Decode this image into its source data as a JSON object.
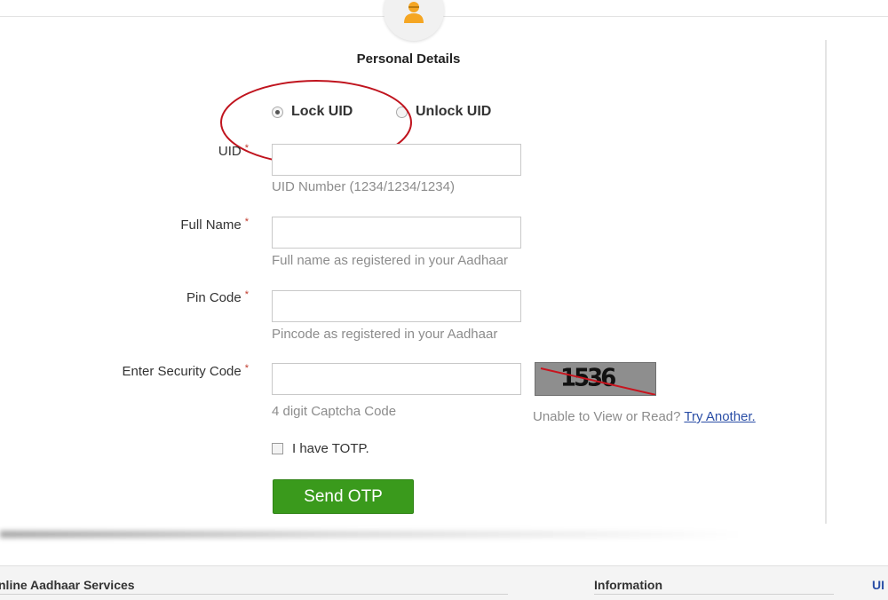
{
  "form": {
    "title": "Personal Details",
    "radio_options": [
      {
        "label": "Lock UID",
        "selected": true
      },
      {
        "label": "Unlock UID",
        "selected": false
      }
    ],
    "fields": {
      "uid": {
        "label": "UID",
        "hint": "UID Number (1234/1234/1234)",
        "value": ""
      },
      "full_name": {
        "label": "Full Name",
        "hint": "Full name as registered in your Aadhaar",
        "value": ""
      },
      "pin_code": {
        "label": "Pin Code",
        "hint": "Pincode as registered in your Aadhaar",
        "value": ""
      },
      "security_code": {
        "label": "Enter Security Code",
        "hint": "4 digit Captcha Code",
        "value": ""
      }
    },
    "required_mark": "*",
    "captcha": {
      "text": "1536"
    },
    "unable_text": "Unable to View or Read?",
    "try_another_label": "Try Another.",
    "totp_label": "I have TOTP.",
    "send_button": "Send OTP"
  },
  "footer": {
    "col1": "nline Aadhaar Services",
    "col2": "Information",
    "col3": "UI"
  },
  "colors": {
    "button_green": "#3a9a1c",
    "annotation_red": "#c0141e",
    "link_blue": "#2a4ea6",
    "avatar_orange": "#f5a623"
  }
}
